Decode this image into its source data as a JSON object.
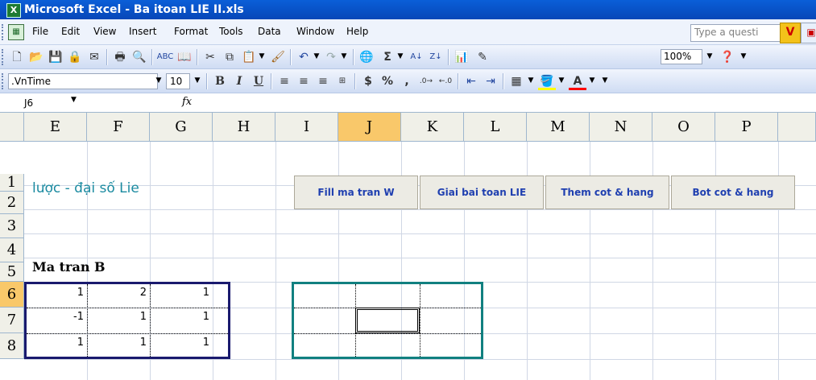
{
  "window": {
    "title": "Microsoft Excel - Ba itoan LIE II.xls",
    "app_icon": "excel-icon"
  },
  "menu": {
    "items": [
      "File",
      "Edit",
      "View",
      "Insert",
      "Format",
      "Tools",
      "Data",
      "Window",
      "Help"
    ],
    "help_placeholder": "Type a questi"
  },
  "standard_toolbar": {
    "zoom": "100%"
  },
  "formatting_toolbar": {
    "font": ".VnTime",
    "size": "10",
    "bold": "B",
    "italic": "I",
    "underline": "U",
    "currency": "$",
    "percent": "%",
    "comma": ","
  },
  "formula_bar": {
    "name_box": "J6",
    "fx": "fx",
    "content": ""
  },
  "sheet": {
    "columns": [
      "E",
      "F",
      "G",
      "H",
      "I",
      "J",
      "K",
      "L",
      "M",
      "N",
      "O",
      "P"
    ],
    "selected_column": "J",
    "rows": [
      "1",
      "2",
      "3",
      "4",
      "5",
      "6",
      "7",
      "8"
    ],
    "selected_row": "6",
    "cell_E1": "lược - đại số Lie",
    "cell_E4": "Ma tran B",
    "matrix_b": [
      [
        "1",
        "2",
        "1"
      ],
      [
        "-1",
        "1",
        "1"
      ],
      [
        "1",
        "1",
        "1"
      ]
    ],
    "buttons": [
      "Fill ma tran W",
      "Giai bai toan LIE",
      "Them cot & hang",
      "Bot cot & hang"
    ]
  }
}
